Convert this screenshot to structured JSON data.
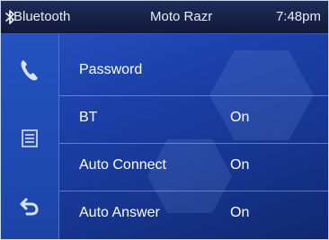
{
  "status_bar": {
    "title": "Bluetooth",
    "device": "Moto Razr",
    "time": "7:48pm",
    "bt_icon": "bluetooth-icon"
  },
  "sidebar": {
    "items": [
      {
        "icon": "phone-icon"
      },
      {
        "icon": "list-icon"
      },
      {
        "icon": "back-icon"
      }
    ]
  },
  "settings": [
    {
      "label": "Password",
      "value": ""
    },
    {
      "label": "BT",
      "value": "On"
    },
    {
      "label": "Auto Connect",
      "value": "On"
    },
    {
      "label": "Auto Answer",
      "value": "On"
    }
  ],
  "colors": {
    "background": "#1d42ad",
    "header": "#121a3a",
    "icon": "#d8e2f6"
  }
}
